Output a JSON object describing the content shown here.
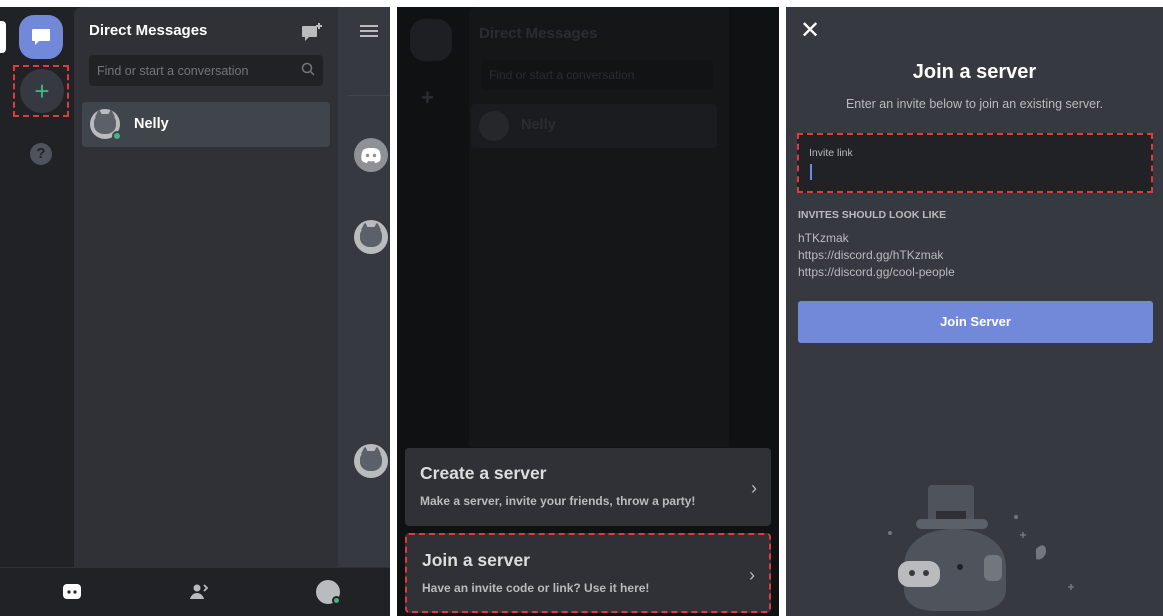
{
  "panel1": {
    "dm_header": {
      "title": "Direct Messages"
    },
    "search": {
      "placeholder": "Find or start a conversation"
    },
    "conversations": [
      {
        "name": "Nelly",
        "status": "online"
      }
    ],
    "server_rail": {
      "add_server_label": "+",
      "help_label": "?"
    }
  },
  "panel2": {
    "options": [
      {
        "title": "Create a server",
        "subtitle": "Make a server, invite your friends, throw a party!"
      },
      {
        "title": "Join a server",
        "subtitle": "Have an invite code or link? Use it here!"
      }
    ],
    "ghost": {
      "header": "Direct Messages",
      "search": "Find or start a conversation",
      "name": "Nelly"
    }
  },
  "panel3": {
    "title": "Join a server",
    "subtitle": "Enter an invite below to join an existing server.",
    "invite_label": "Invite link",
    "examples_heading": "INVITES SHOULD LOOK LIKE",
    "examples": [
      "hTKzmak",
      "https://discord.gg/hTKzmak",
      "https://discord.gg/cool-people"
    ],
    "join_button": "Join Server"
  },
  "colors": {
    "blurple": "#7289da",
    "green": "#43b581",
    "highlight_dashed": "#e03a3a",
    "bg_dark": "#202225",
    "bg_mid": "#2f3136",
    "bg_main": "#36393f"
  }
}
